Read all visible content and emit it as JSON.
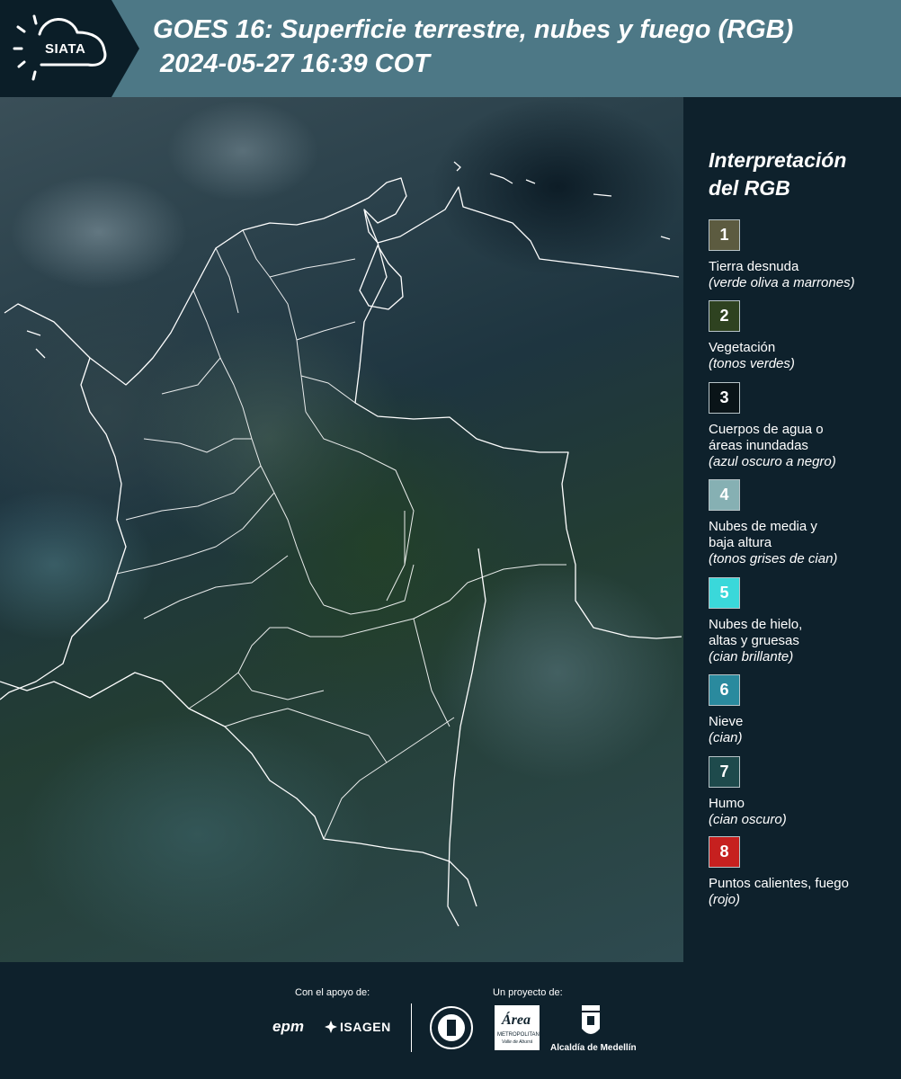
{
  "header": {
    "logo_text": "SIATA",
    "title_line1": "GOES 16: Superficie terrestre, nubes y fuego (RGB)",
    "title_line2": "2024-05-27 16:39 COT"
  },
  "legend": {
    "title_line1": "Interpretación",
    "title_line2": "del RGB",
    "items": [
      {
        "num": "1",
        "color": "#5c5b40",
        "label": "Tierra desnuda",
        "desc": "(verde oliva a marrones)"
      },
      {
        "num": "2",
        "color": "#2e4220",
        "label": "Vegetación",
        "desc": "(tonos verdes)"
      },
      {
        "num": "3",
        "color": "#0a1418",
        "label": "Cuerpos de agua o áreas inundadas",
        "desc": "(azul oscuro a negro)"
      },
      {
        "num": "4",
        "color": "#86b0b3",
        "label": "Nubes de media y baja altura",
        "desc": "(tonos grises de cian)"
      },
      {
        "num": "5",
        "color": "#3ad8da",
        "label": "Nubes de hielo, altas y gruesas",
        "desc": "(cian brillante)"
      },
      {
        "num": "6",
        "color": "#2a8a9e",
        "label": "Nieve",
        "desc": "(cian)"
      },
      {
        "num": "7",
        "color": "#1e4a4c",
        "label": "Humo",
        "desc": "(cian oscuro)"
      },
      {
        "num": "8",
        "color": "#c6201f",
        "label": "Puntos calientes, fuego",
        "desc": "(rojo)"
      }
    ]
  },
  "footer": {
    "support_label": "Con el apoyo de:",
    "project_label": "Un proyecto de:",
    "brand_epm": "epm",
    "brand_isagen": "ISAGEN",
    "brand_area": "Área",
    "brand_area_sub": "METROPOLITANA",
    "brand_area_sub2": "Valle de Aburrá",
    "brand_alcaldia": "Alcaldía de Medellín"
  }
}
